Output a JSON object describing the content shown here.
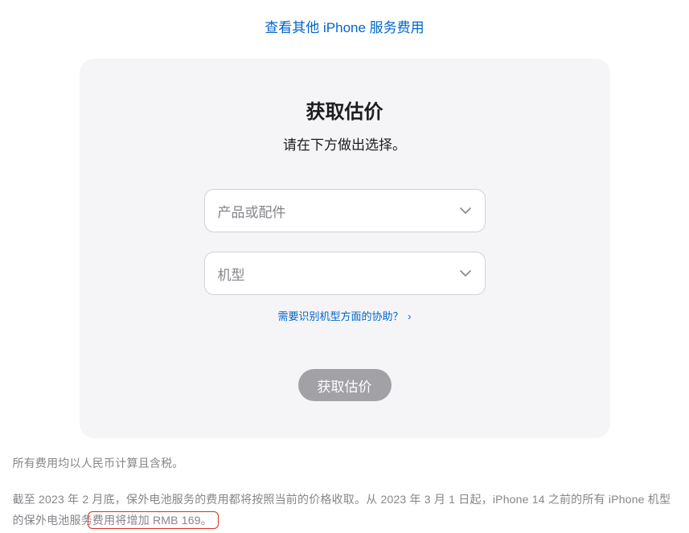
{
  "topLink": {
    "label": "查看其他 iPhone 服务费用"
  },
  "card": {
    "title": "获取估价",
    "subtitle": "请在下方做出选择。",
    "select1_placeholder": "产品或配件",
    "select2_placeholder": "机型",
    "help_link": "需要识别机型方面的协助？",
    "submit_label": "获取估价"
  },
  "footer": {
    "line1": "所有费用均以人民币计算且含税。",
    "line2_prefix": "截至 2023 年 2 月底，保外电池服务的费用都将按照当前的价格收取。从 2023 年 3 月 1 日起，iPhone 14 之前的所有 iPhone 机型的保外电池服务",
    "line2_highlight": "费用将增加 RMB 169。"
  }
}
